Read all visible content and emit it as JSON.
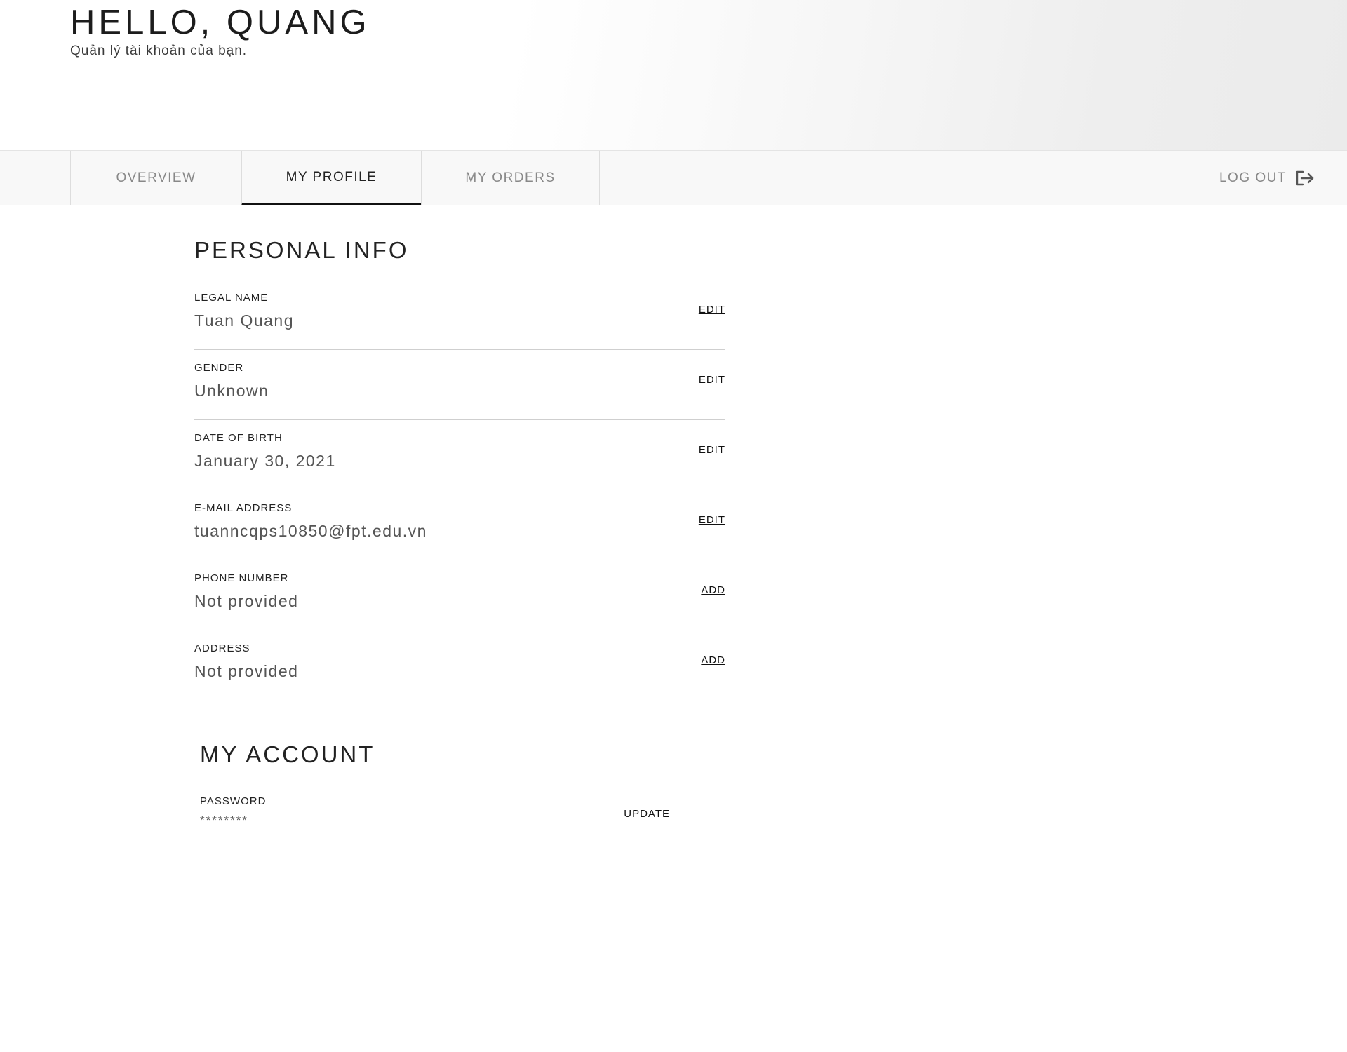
{
  "header": {
    "greeting": "HELLO, QUANG",
    "subtitle": "Quản lý tài khoản của bạn."
  },
  "nav": {
    "tabs": [
      {
        "label": "OVERVIEW",
        "active": false
      },
      {
        "label": "MY PROFILE",
        "active": true
      },
      {
        "label": "MY ORDERS",
        "active": false
      }
    ],
    "logout_label": "LOG OUT",
    "logout_icon": "logout-icon"
  },
  "personal_info": {
    "title": "PERSONAL INFO",
    "fields": [
      {
        "label": "LEGAL NAME",
        "value": "Tuan Quang",
        "action": "EDIT"
      },
      {
        "label": "GENDER",
        "value": "Unknown",
        "action": "EDIT"
      },
      {
        "label": "DATE OF BIRTH",
        "value": "January 30, 2021",
        "action": "EDIT"
      },
      {
        "label": "E-MAIL ADDRESS",
        "value": "tuanncqps10850@fpt.edu.vn",
        "action": "EDIT"
      },
      {
        "label": "PHONE NUMBER",
        "value": "Not provided",
        "action": "ADD"
      },
      {
        "label": "ADDRESS",
        "value": "Not provided",
        "action": "ADD"
      }
    ]
  },
  "my_account": {
    "title": "MY ACCOUNT",
    "password_label": "PASSWORD",
    "password_value": "********",
    "update_label": "UPDATE"
  },
  "colors": {
    "text": "#1a1a1a",
    "muted": "#888888",
    "nav_bg": "#f8f8f8",
    "active_tab_border": "#111111"
  }
}
